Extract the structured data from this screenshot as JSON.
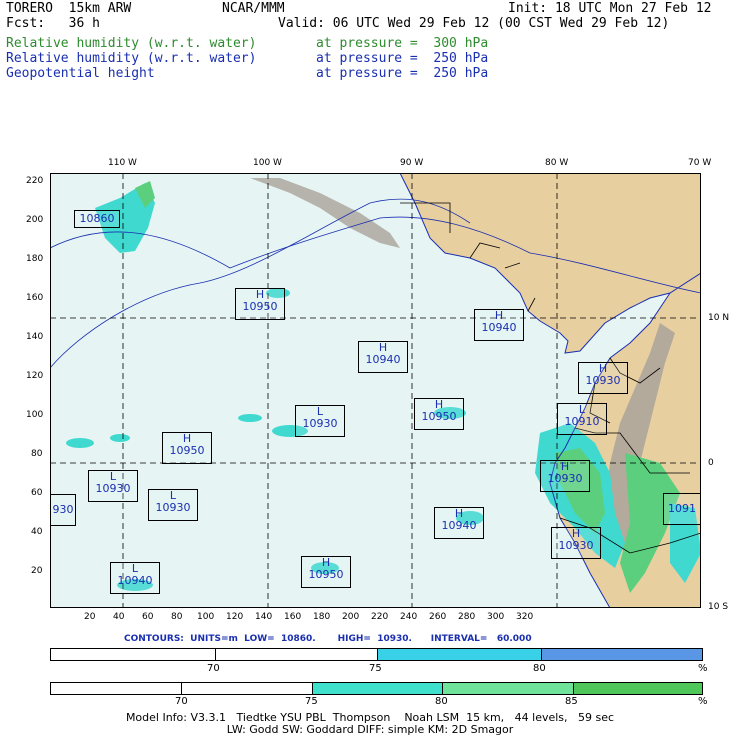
{
  "header": {
    "line1_left": "TORERO  15km ARW",
    "line1_mid": "NCAR/MMM",
    "line1_right": "Init: 18 UTC Mon 27 Feb 12",
    "line2_left": "Fcst:   36 h",
    "line2_right": "Valid: 06 UTC Wed 29 Feb 12 (00 CST Wed 29 Feb 12)",
    "fields": [
      {
        "name": "Relative humidity (w.r.t. water)",
        "pressure": "at pressure =  300 hPa",
        "color": "#2e8b2e"
      },
      {
        "name": "Relative humidity (w.r.t. water)",
        "pressure": "at pressure =  250 hPa",
        "color": "#1a2fb0"
      },
      {
        "name": "Geopotential height",
        "pressure": "at pressure =  250 hPa",
        "color": "#1a2fb0"
      }
    ]
  },
  "map": {
    "top_ticks": [
      "110 W",
      "100 W",
      "90 W",
      "80 W",
      "70 W"
    ],
    "left_ticks": [
      "220",
      "200",
      "180",
      "160",
      "140",
      "120",
      "100",
      "80",
      "60",
      "40",
      "20"
    ],
    "bottom_ticks": [
      "20",
      "40",
      "60",
      "80",
      "100",
      "120",
      "140",
      "160",
      "180",
      "200",
      "220",
      "240",
      "260",
      "280",
      "300",
      "320"
    ],
    "right_ticks": [
      "10 N",
      "0",
      "10 S"
    ],
    "colors": {
      "ocean": "#e6f5f4",
      "land": "#e8cfa0",
      "mountain": "#a9a39a",
      "humid_cyan": "#3fd9cf",
      "humid_green": "#5bcf7e",
      "border": "#000000",
      "coast": "#1a2fb0"
    },
    "centers": [
      {
        "letter": "",
        "value": "10860"
      },
      {
        "letter": "H",
        "value": "10950"
      },
      {
        "letter": "H",
        "value": "10940"
      },
      {
        "letter": "H",
        "value": "10940"
      },
      {
        "letter": "H",
        "value": "10930"
      },
      {
        "letter": "L",
        "value": "10930"
      },
      {
        "letter": "H",
        "value": "10950"
      },
      {
        "letter": "L",
        "value": "10910"
      },
      {
        "letter": "H",
        "value": "10950"
      },
      {
        "letter": "L",
        "value": "10930"
      },
      {
        "letter": "H",
        "value": "10930"
      },
      {
        "letter": "L",
        "value": "10930"
      },
      {
        "letter": "",
        "value": "930"
      },
      {
        "letter": "H",
        "value": "10940"
      },
      {
        "letter": "H",
        "value": "10930"
      },
      {
        "letter": "",
        "value": "1091"
      },
      {
        "letter": "H",
        "value": "10950"
      },
      {
        "letter": "L",
        "value": "10940"
      }
    ]
  },
  "contours": {
    "text": "CONTOURS:  UNITS=m  LOW=  10860.       HIGH=  10930.      INTERVAL=   60.000"
  },
  "bar1": {
    "labels": [
      "70",
      "75",
      "80",
      "%"
    ],
    "colors": [
      "#ffffff",
      "#ffffff",
      "#38d1e8",
      "#5a96e6"
    ]
  },
  "bar2": {
    "labels": [
      "70",
      "75",
      "80",
      "85",
      "%"
    ],
    "colors": [
      "#ffffff",
      "#ffffff",
      "#3fe0cc",
      "#6fe39a",
      "#4fc75a"
    ]
  },
  "footer": {
    "line1": "Model Info: V3.3.1   Tiedtke YSU PBL  Thompson    Noah LSM  15 km,   44 levels,   59 sec",
    "line2": "LW: Godd SW: Goddard DIFF: simple KM: 2D Smagor"
  }
}
